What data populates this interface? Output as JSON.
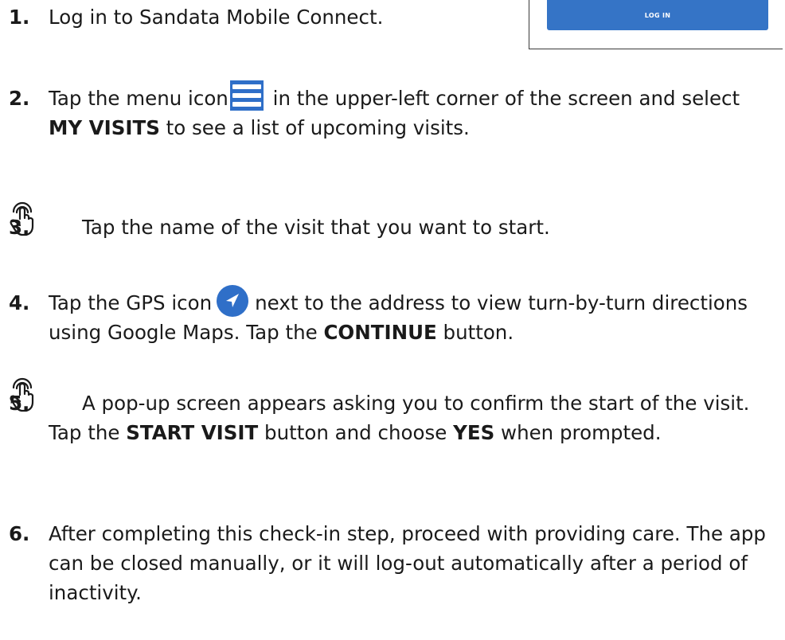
{
  "login_panel": {
    "button_label": "LOG IN"
  },
  "steps": [
    {
      "number": "1.",
      "text": "Log in to Sandata Mobile Connect."
    },
    {
      "number": "2.",
      "before_icon": "Tap the menu icon",
      "icon": "menu-icon",
      "after_icon": " in the upper-left corner of the screen and select ",
      "bold1": "MY VISITS",
      "after_bold1": " to see a list of upcoming visits."
    },
    {
      "number": "3.",
      "icon": "tap-gesture-icon",
      "text": "Tap the name of the visit that you want to start."
    },
    {
      "number": "4.",
      "before_icon": "Tap the GPS icon",
      "icon": "gps-navigation-icon",
      "after_icon": "next to the address to view turn-by-turn directions using Google Maps.  Tap the ",
      "bold1": "CONTINUE",
      "after_bold1": " button."
    },
    {
      "number": "5.",
      "icon": "tap-gesture-icon",
      "text": "A pop-up screen appears asking you to confirm the start of the visit.  Tap the ",
      "bold1": "START VISIT",
      "after_bold1": " button and choose ",
      "bold2": "YES",
      "after_bold2": " when prompted."
    },
    {
      "number": "6.",
      "text": "After completing this check-in step, proceed with providing care. The app can be closed manually, or it will log-out automatically after a period of inactivity."
    }
  ],
  "colors": {
    "accent_blue": "#2f6fc8",
    "button_blue": "#3574c6",
    "text": "#1a1a1a"
  }
}
